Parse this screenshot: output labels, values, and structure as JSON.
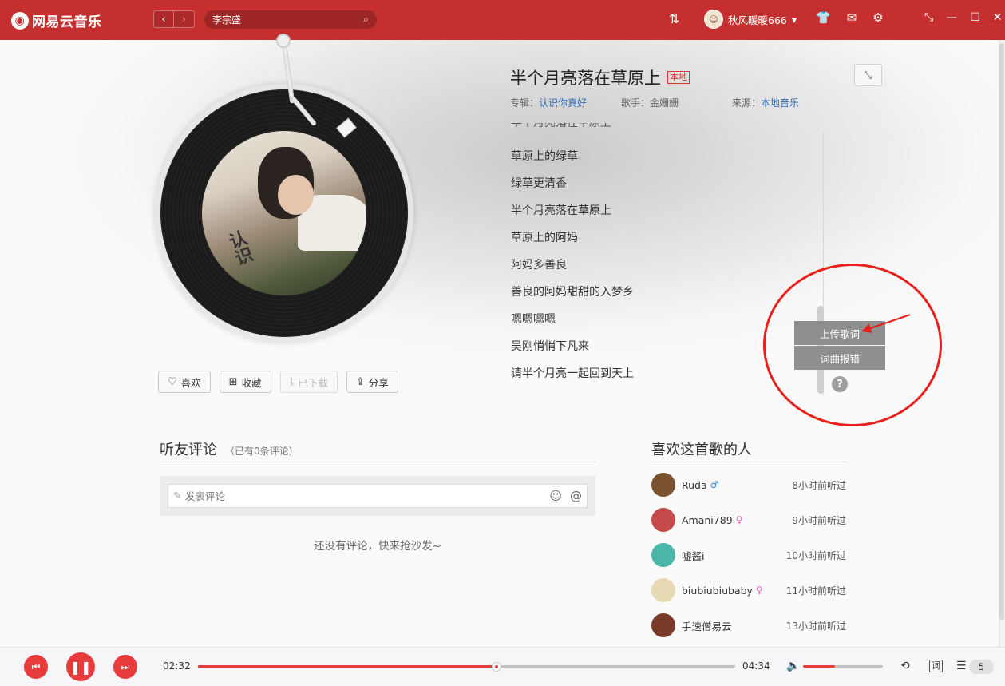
{
  "app": {
    "logo_text": "网易云音乐",
    "logo_glyph": "◉"
  },
  "titlebar": {
    "back": "‹",
    "forward": "›",
    "search_value": "李宗盛",
    "user_name": "秋风暖暖666",
    "avatar_glyph": "☺"
  },
  "song": {
    "title": "半个月亮落在草原上",
    "tag": "本地",
    "album_label": "专辑：",
    "album": "认识你真好",
    "artist_label": "歌手：",
    "artist": "金姗姗",
    "source_label": "来源：",
    "source": "本地音乐",
    "cover_text": "认识"
  },
  "lyrics": {
    "partial_top": "半个月亮落在草原上",
    "lines": [
      "草原上的绿草",
      "绿草更清香",
      "半个月亮落在草原上",
      "草原上的阿妈",
      "阿妈多善良",
      "善良的阿妈甜甜的入梦乡",
      "嗯嗯嗯嗯",
      "吴刚悄悄下凡来",
      "请半个月亮一起回到天上"
    ]
  },
  "lyric_menu": {
    "upload": "上传歌词",
    "report": "词曲报错",
    "help": "?"
  },
  "actions": {
    "like": "喜欢",
    "collect": "收藏",
    "download": "已下载",
    "share": "分享"
  },
  "comments": {
    "title": "听友评论",
    "count": "（已有0条评论）",
    "placeholder": "发表评论",
    "empty": "还没有评论，快来抢沙发~"
  },
  "likers": {
    "title": "喜欢这首歌的人",
    "items": [
      {
        "name": "Ruda",
        "gender": "♂",
        "gender_color": "#2e8bd0",
        "time": "8小时前听过",
        "avatar_color": "#7a5230"
      },
      {
        "name": "Amani789",
        "gender": "♀",
        "gender_color": "#e866c2",
        "time": "9小时前听过",
        "avatar_color": "#c74a4a"
      },
      {
        "name": "嘘酱i",
        "gender": "",
        "gender_color": "#e866c2",
        "time": "10小时前听过",
        "avatar_color": "#4cb6a8"
      },
      {
        "name": "biubiubiubaby",
        "gender": "♀",
        "gender_color": "#e866c2",
        "time": "11小时前听过",
        "avatar_color": "#e8d9b5"
      },
      {
        "name": "手速僧易云",
        "gender": "",
        "gender_color": "#e866c2",
        "time": "13小时前听过",
        "avatar_color": "#7a3a2a"
      }
    ]
  },
  "player": {
    "current_time": "02:32",
    "total_time": "04:34",
    "progress": 0.555,
    "volume": 0.4,
    "playlist_count": "5",
    "lyric_toggle": "词"
  },
  "colors": {
    "brand": "#c62f2f",
    "accent": "#e83c3c",
    "link": "#2e6bb6",
    "annotation": "#e8201b"
  }
}
